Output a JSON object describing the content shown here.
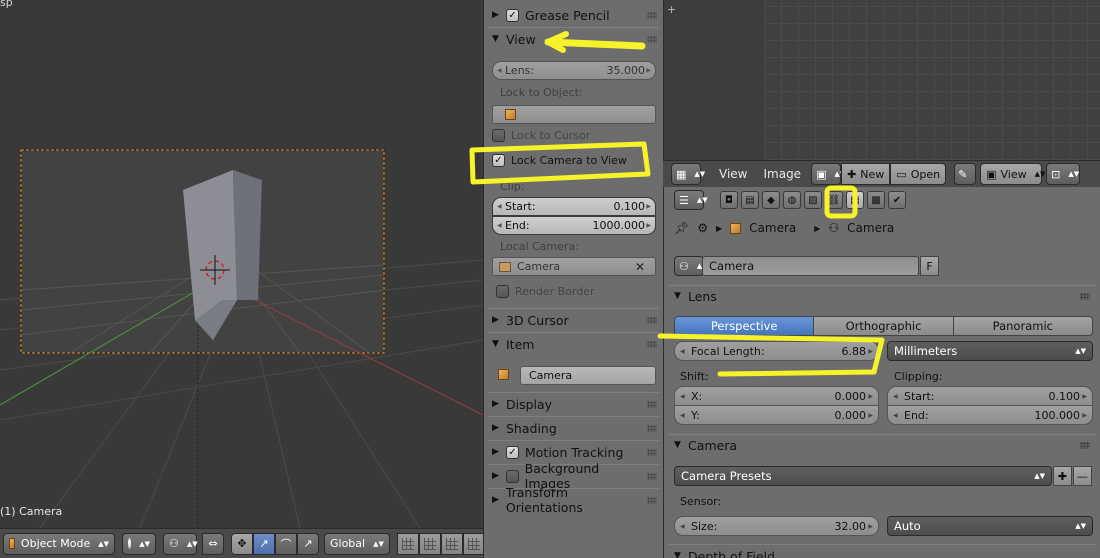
{
  "viewport": {
    "corner_text": "sp",
    "object_label": "(1) Camera"
  },
  "viewport_header": {
    "mode": "Object Mode",
    "orientation": "Global"
  },
  "npanel": {
    "grease_pencil": "Grease Pencil",
    "view": "View",
    "lens_label": "Lens:",
    "lens_value": "35.000",
    "lock_to_object": "Lock to Object:",
    "lock_to_cursor": "Lock to Cursor",
    "lock_camera_to_view": "Lock Camera to View",
    "clip": "Clip:",
    "clip_start_label": "Start:",
    "clip_start": "0.100",
    "clip_end_label": "End:",
    "clip_end": "1000.000",
    "local_camera": "Local Camera:",
    "local_camera_value": "Camera",
    "render_border": "Render Border",
    "cursor_3d": "3D Cursor",
    "item": "Item",
    "item_name": "Camera",
    "display": "Display",
    "shading": "Shading",
    "motion_tracking": "Motion Tracking",
    "background_images": "Background Images",
    "transform_orientations": "Transform Orientations"
  },
  "image_editor": {
    "menu_view": "View",
    "menu_image": "Image",
    "new_button": "New",
    "open_button": "Open",
    "view_select": "View"
  },
  "properties": {
    "breadcrumb_object": "Camera",
    "breadcrumb_data": "Camera",
    "datablock_name": "Camera",
    "fake_user": "F",
    "lens_section": "Lens",
    "lens_types": [
      "Perspective",
      "Orthographic",
      "Panoramic"
    ],
    "focal_length_label": "Focal Length:",
    "focal_length": "6.88",
    "lens_unit": "Millimeters",
    "shift_label": "Shift:",
    "shift_x_label": "X:",
    "shift_x": "0.000",
    "shift_y_label": "Y:",
    "shift_y": "0.000",
    "clipping_label": "Clipping:",
    "clip_start_label": "Start:",
    "clip_start": "0.100",
    "clip_end_label": "End:",
    "clip_end": "100.000",
    "camera_section": "Camera",
    "camera_presets": "Camera Presets",
    "sensor_label": "Sensor:",
    "size_label": "Size:",
    "size_value": "32.00",
    "sensor_fit": "Auto",
    "dof_section": "Depth of Field"
  },
  "colors": {
    "highlight": "#f6f32a",
    "active_blue": "#4c74bc"
  }
}
